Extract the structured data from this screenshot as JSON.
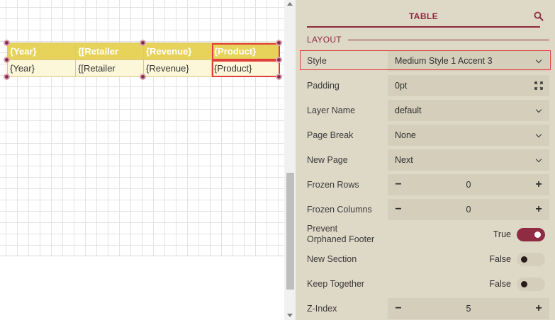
{
  "report_table": {
    "header_cells": [
      "{Year}",
      "{[Retailer",
      "{Revenue}",
      "{Product}"
    ],
    "detail_cells": [
      "{Year}",
      "{[Retailer",
      "{Revenue}",
      "{Product}"
    ],
    "header_color": "#e7d25a",
    "detail_color": "#fcf7d9",
    "selected_column": 3
  },
  "panel": {
    "tab_label": "TABLE",
    "search_icon": "search-icon",
    "section_title": "LAYOUT",
    "accent_color": "#8c2a3f",
    "properties": {
      "style": {
        "label": "Style",
        "value": "Medium Style 1 Accent 3"
      },
      "padding": {
        "label": "Padding",
        "value": "0pt",
        "icon": "expand-icon"
      },
      "layer_name": {
        "label": "Layer Name",
        "value": "default"
      },
      "page_break": {
        "label": "Page Break",
        "value": "None"
      },
      "new_page": {
        "label": "New Page",
        "value": "Next"
      },
      "frozen_rows": {
        "label": "Frozen Rows",
        "value": "0"
      },
      "frozen_columns": {
        "label": "Frozen Columns",
        "value": "0"
      },
      "prevent_orphaned_footer": {
        "label_line1": "Prevent",
        "label_line2": "Orphaned Footer",
        "value": "True",
        "on": true
      },
      "new_section": {
        "label": "New Section",
        "value": "False",
        "on": false
      },
      "keep_together": {
        "label": "Keep Together",
        "value": "False",
        "on": false
      },
      "z_index": {
        "label": "Z-Index",
        "value": "5"
      }
    }
  }
}
